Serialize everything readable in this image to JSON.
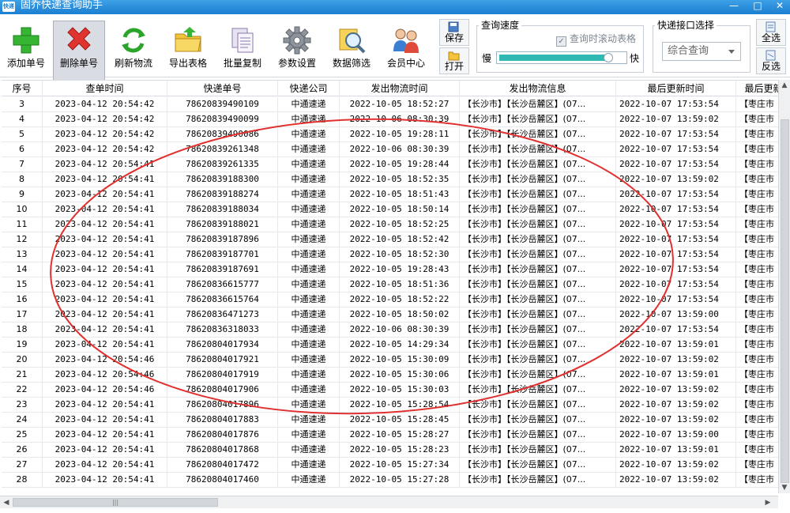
{
  "window": {
    "title": "固乔快递查询助手",
    "icon_text": "快递"
  },
  "toolbar": {
    "buttons": [
      {
        "label": "添加单号",
        "icon": "plus-icon"
      },
      {
        "label": "删除单号",
        "icon": "delete-x-icon"
      },
      {
        "label": "刷新物流",
        "icon": "refresh-icon"
      },
      {
        "label": "导出表格",
        "icon": "folder-export-icon"
      },
      {
        "label": "批量复制",
        "icon": "copy-icon"
      },
      {
        "label": "参数设置",
        "icon": "gear-icon"
      },
      {
        "label": "数据筛选",
        "icon": "magnifier-filter-icon"
      },
      {
        "label": "会员中心",
        "icon": "members-icon"
      }
    ],
    "save_label": "保存",
    "open_label": "打开",
    "select_all_label": "全选",
    "invert_label": "反选"
  },
  "speed": {
    "title": "查询速度",
    "checkbox_label": "查询时滚动表格",
    "checkbox_checked": true,
    "slow_label": "慢",
    "fast_label": "快",
    "level": 0.88
  },
  "api": {
    "title": "快递接口选择",
    "selected": "综合查询"
  },
  "table": {
    "columns": [
      "序号",
      "查单时间",
      "快递单号",
      "快递公司",
      "发出物流时间",
      "发出物流信息",
      "最后更新时间",
      "最后更新"
    ],
    "rows": [
      [
        "3",
        "2023-04-12 20:54:42",
        "78620839490109",
        "中通速递",
        "2022-10-05 18:52:27",
        "【长沙市】【长沙岳麓区】(07...",
        "2022-10-07 17:53:54",
        "【枣庄市"
      ],
      [
        "4",
        "2023-04-12 20:54:42",
        "78620839490099",
        "中通速递",
        "2022-10-06 08:30:39",
        "【长沙市】【长沙岳麓区】(07...",
        "2022-10-07 13:59:02",
        "【枣庄市"
      ],
      [
        "5",
        "2023-04-12 20:54:42",
        "78620839490086",
        "中通速递",
        "2022-10-05 19:28:11",
        "【长沙市】【长沙岳麓区】(07...",
        "2022-10-07 17:53:54",
        "【枣庄市"
      ],
      [
        "6",
        "2023-04-12 20:54:42",
        "78620839261348",
        "中通速递",
        "2022-10-06 08:30:39",
        "【长沙市】【长沙岳麓区】(07...",
        "2022-10-07 17:53:54",
        "【枣庄市"
      ],
      [
        "7",
        "2023-04-12 20:54:41",
        "78620839261335",
        "中通速递",
        "2022-10-05 19:28:44",
        "【长沙市】【长沙岳麓区】(07...",
        "2022-10-07 17:53:54",
        "【枣庄市"
      ],
      [
        "8",
        "2023-04-12 20:54:41",
        "78620839188300",
        "中通速递",
        "2022-10-05 18:52:35",
        "【长沙市】【长沙岳麓区】(07...",
        "2022-10-07 13:59:02",
        "【枣庄市"
      ],
      [
        "9",
        "2023-04-12 20:54:41",
        "78620839188274",
        "中通速递",
        "2022-10-05 18:51:43",
        "【长沙市】【长沙岳麓区】(07...",
        "2022-10-07 17:53:54",
        "【枣庄市"
      ],
      [
        "10",
        "2023-04-12 20:54:41",
        "78620839188034",
        "中通速递",
        "2022-10-05 18:50:14",
        "【长沙市】【长沙岳麓区】(07...",
        "2022-10-07 17:53:54",
        "【枣庄市"
      ],
      [
        "11",
        "2023-04-12 20:54:41",
        "78620839188021",
        "中通速递",
        "2022-10-05 18:52:25",
        "【长沙市】【长沙岳麓区】(07...",
        "2022-10-07 17:53:54",
        "【枣庄市"
      ],
      [
        "12",
        "2023-04-12 20:54:41",
        "78620839187896",
        "中通速递",
        "2022-10-05 18:52:42",
        "【长沙市】【长沙岳麓区】(07...",
        "2022-10-07 17:53:54",
        "【枣庄市"
      ],
      [
        "13",
        "2023-04-12 20:54:41",
        "78620839187701",
        "中通速递",
        "2022-10-05 18:52:30",
        "【长沙市】【长沙岳麓区】(07...",
        "2022-10-07 17:53:54",
        "【枣庄市"
      ],
      [
        "14",
        "2023-04-12 20:54:41",
        "78620839187691",
        "中通速递",
        "2022-10-05 19:28:43",
        "【长沙市】【长沙岳麓区】(07...",
        "2022-10-07 17:53:54",
        "【枣庄市"
      ],
      [
        "15",
        "2023-04-12 20:54:41",
        "78620836615777",
        "中通速递",
        "2022-10-05 18:51:36",
        "【长沙市】【长沙岳麓区】(07...",
        "2022-10-07 17:53:54",
        "【枣庄市"
      ],
      [
        "16",
        "2023-04-12 20:54:41",
        "78620836615764",
        "中通速递",
        "2022-10-05 18:52:22",
        "【长沙市】【长沙岳麓区】(07...",
        "2022-10-07 17:53:54",
        "【枣庄市"
      ],
      [
        "17",
        "2023-04-12 20:54:41",
        "78620836471273",
        "中通速递",
        "2022-10-05 18:50:02",
        "【长沙市】【长沙岳麓区】(07...",
        "2022-10-07 13:59:00",
        "【枣庄市"
      ],
      [
        "18",
        "2023-04-12 20:54:41",
        "78620836318033",
        "中通速递",
        "2022-10-06 08:30:39",
        "【长沙市】【长沙岳麓区】(07...",
        "2022-10-07 17:53:54",
        "【枣庄市"
      ],
      [
        "19",
        "2023-04-12 20:54:41",
        "78620804017934",
        "中通速递",
        "2022-10-05 14:29:34",
        "【长沙市】【长沙岳麓区】(07...",
        "2022-10-07 13:59:01",
        "【枣庄市"
      ],
      [
        "20",
        "2023-04-12 20:54:46",
        "78620804017921",
        "中通速递",
        "2022-10-05 15:30:09",
        "【长沙市】【长沙岳麓区】(07...",
        "2022-10-07 13:59:02",
        "【枣庄市"
      ],
      [
        "21",
        "2023-04-12 20:54:46",
        "78620804017919",
        "中通速递",
        "2022-10-05 15:30:06",
        "【长沙市】【长沙岳麓区】(07...",
        "2022-10-07 13:59:01",
        "【枣庄市"
      ],
      [
        "22",
        "2023-04-12 20:54:46",
        "78620804017906",
        "中通速递",
        "2022-10-05 15:30:03",
        "【长沙市】【长沙岳麓区】(07...",
        "2022-10-07 13:59:02",
        "【枣庄市"
      ],
      [
        "23",
        "2023-04-12 20:54:41",
        "78620804017896",
        "中通速递",
        "2022-10-05 15:28:54",
        "【长沙市】【长沙岳麓区】(07...",
        "2022-10-07 13:59:02",
        "【枣庄市"
      ],
      [
        "24",
        "2023-04-12 20:54:41",
        "78620804017883",
        "中通速递",
        "2022-10-05 15:28:45",
        "【长沙市】【长沙岳麓区】(07...",
        "2022-10-07 13:59:02",
        "【枣庄市"
      ],
      [
        "25",
        "2023-04-12 20:54:41",
        "78620804017876",
        "中通速递",
        "2022-10-05 15:28:27",
        "【长沙市】【长沙岳麓区】(07...",
        "2022-10-07 13:59:00",
        "【枣庄市"
      ],
      [
        "26",
        "2023-04-12 20:54:41",
        "78620804017868",
        "中通速递",
        "2022-10-05 15:28:23",
        "【长沙市】【长沙岳麓区】(07...",
        "2022-10-07 13:59:01",
        "【枣庄市"
      ],
      [
        "27",
        "2023-04-12 20:54:41",
        "78620804017472",
        "中通速递",
        "2022-10-05 15:27:34",
        "【长沙市】【长沙岳麓区】(07...",
        "2022-10-07 13:59:02",
        "【枣庄市"
      ],
      [
        "28",
        "2023-04-12 20:54:41",
        "78620804017460",
        "中通速递",
        "2022-10-05 15:27:28",
        "【长沙市】【长沙岳麓区】(07...",
        "2022-10-07 13:59:02",
        "【枣庄市"
      ]
    ]
  },
  "scroll": {
    "h_thumb_grip": "|||"
  },
  "colors": {
    "titlebar": "#1b7fd1",
    "slider_fill": "#2fb9b2",
    "annotation": "#e0302f"
  }
}
